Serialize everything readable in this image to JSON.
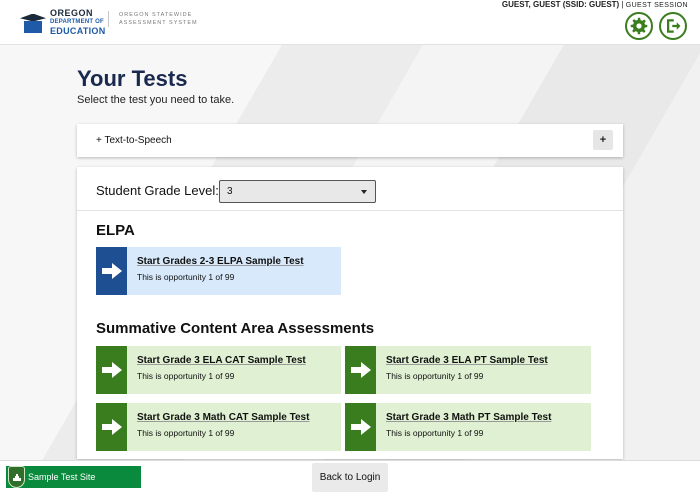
{
  "header": {
    "logo": {
      "line1": "OREGON",
      "line2": "DEPARTMENT OF",
      "line3": "EDUCATION"
    },
    "system_name": "OREGON STATEWIDE ASSESSMENT SYSTEM",
    "user_name": "GUEST, GUEST (SSID: GUEST)",
    "separator": " | ",
    "session": "GUEST SESSION",
    "settings_icon": "gear-icon",
    "logout_icon": "logout-icon"
  },
  "page": {
    "title": "Your Tests",
    "subtitle": "Select the test you need to take."
  },
  "tts": {
    "label": "+ Text-to-Speech",
    "expand_label": "+"
  },
  "grade": {
    "label": "Student Grade Level:",
    "selected": "3"
  },
  "sections": {
    "elpa": {
      "heading": "ELPA",
      "tests": [
        {
          "name": "Start Grades 2-3 ELPA Sample Test",
          "opportunity": "This is opportunity 1 of 99"
        }
      ]
    },
    "summative": {
      "heading": "Summative Content Area Assessments",
      "tests": [
        {
          "name": "Start Grade 3 ELA CAT Sample Test",
          "opportunity": "This is opportunity 1 of 99"
        },
        {
          "name": "Start Grade 3 ELA PT Sample Test",
          "opportunity": "This is opportunity 1 of 99"
        },
        {
          "name": "Start Grade 3 Math CAT Sample Test",
          "opportunity": "This is opportunity 1 of 99"
        },
        {
          "name": "Start Grade 3 Math PT Sample Test",
          "opportunity": "This is opportunity 1 of 99"
        }
      ]
    }
  },
  "footer": {
    "site_label": "Sample Test Site",
    "back_label": "Back to Login"
  },
  "colors": {
    "title": "#1a2a4f",
    "elpa_accent": "#1d4f92",
    "summative_accent": "#3a7d1e",
    "site_badge": "#0a8a3c"
  }
}
